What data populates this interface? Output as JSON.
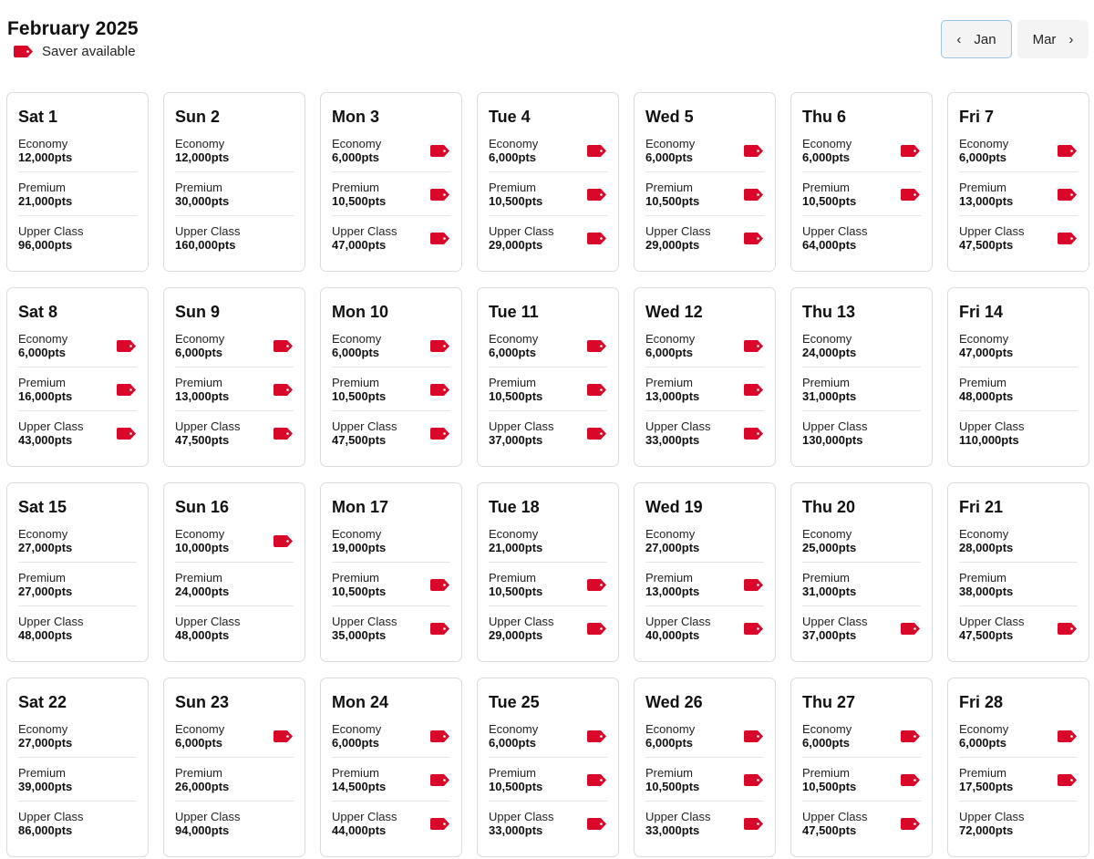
{
  "header": {
    "title": "February 2025",
    "legend_label": "Saver available",
    "saver_color": "#d9072a"
  },
  "nav": {
    "prev_label": "Jan",
    "next_label": "Mar"
  },
  "fare_classes": [
    "Economy",
    "Premium",
    "Upper Class"
  ],
  "days": [
    {
      "label": "Sat 1",
      "fares": [
        {
          "pts": "12,000pts",
          "saver": false
        },
        {
          "pts": "21,000pts",
          "saver": false
        },
        {
          "pts": "96,000pts",
          "saver": false
        }
      ]
    },
    {
      "label": "Sun 2",
      "fares": [
        {
          "pts": "12,000pts",
          "saver": false
        },
        {
          "pts": "30,000pts",
          "saver": false
        },
        {
          "pts": "160,000pts",
          "saver": false
        }
      ]
    },
    {
      "label": "Mon 3",
      "fares": [
        {
          "pts": "6,000pts",
          "saver": true
        },
        {
          "pts": "10,500pts",
          "saver": true
        },
        {
          "pts": "47,000pts",
          "saver": true
        }
      ]
    },
    {
      "label": "Tue 4",
      "fares": [
        {
          "pts": "6,000pts",
          "saver": true
        },
        {
          "pts": "10,500pts",
          "saver": true
        },
        {
          "pts": "29,000pts",
          "saver": true
        }
      ]
    },
    {
      "label": "Wed 5",
      "fares": [
        {
          "pts": "6,000pts",
          "saver": true
        },
        {
          "pts": "10,500pts",
          "saver": true
        },
        {
          "pts": "29,000pts",
          "saver": true
        }
      ]
    },
    {
      "label": "Thu 6",
      "fares": [
        {
          "pts": "6,000pts",
          "saver": true
        },
        {
          "pts": "10,500pts",
          "saver": true
        },
        {
          "pts": "64,000pts",
          "saver": false
        }
      ]
    },
    {
      "label": "Fri 7",
      "fares": [
        {
          "pts": "6,000pts",
          "saver": true
        },
        {
          "pts": "13,000pts",
          "saver": true
        },
        {
          "pts": "47,500pts",
          "saver": true
        }
      ]
    },
    {
      "label": "Sat 8",
      "fares": [
        {
          "pts": "6,000pts",
          "saver": true
        },
        {
          "pts": "16,000pts",
          "saver": true
        },
        {
          "pts": "43,000pts",
          "saver": true
        }
      ]
    },
    {
      "label": "Sun 9",
      "fares": [
        {
          "pts": "6,000pts",
          "saver": true
        },
        {
          "pts": "13,000pts",
          "saver": true
        },
        {
          "pts": "47,500pts",
          "saver": true
        }
      ]
    },
    {
      "label": "Mon 10",
      "fares": [
        {
          "pts": "6,000pts",
          "saver": true
        },
        {
          "pts": "10,500pts",
          "saver": true
        },
        {
          "pts": "47,500pts",
          "saver": true
        }
      ]
    },
    {
      "label": "Tue 11",
      "fares": [
        {
          "pts": "6,000pts",
          "saver": true
        },
        {
          "pts": "10,500pts",
          "saver": true
        },
        {
          "pts": "37,000pts",
          "saver": true
        }
      ]
    },
    {
      "label": "Wed 12",
      "fares": [
        {
          "pts": "6,000pts",
          "saver": true
        },
        {
          "pts": "13,000pts",
          "saver": true
        },
        {
          "pts": "33,000pts",
          "saver": true
        }
      ]
    },
    {
      "label": "Thu 13",
      "fares": [
        {
          "pts": "24,000pts",
          "saver": false
        },
        {
          "pts": "31,000pts",
          "saver": false
        },
        {
          "pts": "130,000pts",
          "saver": false
        }
      ]
    },
    {
      "label": "Fri 14",
      "fares": [
        {
          "pts": "47,000pts",
          "saver": false
        },
        {
          "pts": "48,000pts",
          "saver": false
        },
        {
          "pts": "110,000pts",
          "saver": false
        }
      ]
    },
    {
      "label": "Sat 15",
      "fares": [
        {
          "pts": "27,000pts",
          "saver": false
        },
        {
          "pts": "27,000pts",
          "saver": false
        },
        {
          "pts": "48,000pts",
          "saver": false
        }
      ]
    },
    {
      "label": "Sun 16",
      "fares": [
        {
          "pts": "10,000pts",
          "saver": true
        },
        {
          "pts": "24,000pts",
          "saver": false
        },
        {
          "pts": "48,000pts",
          "saver": false
        }
      ]
    },
    {
      "label": "Mon 17",
      "fares": [
        {
          "pts": "19,000pts",
          "saver": false
        },
        {
          "pts": "10,500pts",
          "saver": true
        },
        {
          "pts": "35,000pts",
          "saver": true
        }
      ]
    },
    {
      "label": "Tue 18",
      "fares": [
        {
          "pts": "21,000pts",
          "saver": false
        },
        {
          "pts": "10,500pts",
          "saver": true
        },
        {
          "pts": "29,000pts",
          "saver": true
        }
      ]
    },
    {
      "label": "Wed 19",
      "fares": [
        {
          "pts": "27,000pts",
          "saver": false
        },
        {
          "pts": "13,000pts",
          "saver": true
        },
        {
          "pts": "40,000pts",
          "saver": true
        }
      ]
    },
    {
      "label": "Thu 20",
      "fares": [
        {
          "pts": "25,000pts",
          "saver": false
        },
        {
          "pts": "31,000pts",
          "saver": false
        },
        {
          "pts": "37,000pts",
          "saver": true
        }
      ]
    },
    {
      "label": "Fri 21",
      "fares": [
        {
          "pts": "28,000pts",
          "saver": false
        },
        {
          "pts": "38,000pts",
          "saver": false
        },
        {
          "pts": "47,500pts",
          "saver": true
        }
      ]
    },
    {
      "label": "Sat 22",
      "fares": [
        {
          "pts": "27,000pts",
          "saver": false
        },
        {
          "pts": "39,000pts",
          "saver": false
        },
        {
          "pts": "86,000pts",
          "saver": false
        }
      ]
    },
    {
      "label": "Sun 23",
      "fares": [
        {
          "pts": "6,000pts",
          "saver": true
        },
        {
          "pts": "26,000pts",
          "saver": false
        },
        {
          "pts": "94,000pts",
          "saver": false
        }
      ]
    },
    {
      "label": "Mon 24",
      "fares": [
        {
          "pts": "6,000pts",
          "saver": true
        },
        {
          "pts": "14,500pts",
          "saver": true
        },
        {
          "pts": "44,000pts",
          "saver": true
        }
      ]
    },
    {
      "label": "Tue 25",
      "fares": [
        {
          "pts": "6,000pts",
          "saver": true
        },
        {
          "pts": "10,500pts",
          "saver": true
        },
        {
          "pts": "33,000pts",
          "saver": true
        }
      ]
    },
    {
      "label": "Wed 26",
      "fares": [
        {
          "pts": "6,000pts",
          "saver": true
        },
        {
          "pts": "10,500pts",
          "saver": true
        },
        {
          "pts": "33,000pts",
          "saver": true
        }
      ]
    },
    {
      "label": "Thu 27",
      "fares": [
        {
          "pts": "6,000pts",
          "saver": true
        },
        {
          "pts": "10,500pts",
          "saver": true
        },
        {
          "pts": "47,500pts",
          "saver": true
        }
      ]
    },
    {
      "label": "Fri 28",
      "fares": [
        {
          "pts": "6,000pts",
          "saver": true
        },
        {
          "pts": "17,500pts",
          "saver": true
        },
        {
          "pts": "72,000pts",
          "saver": false
        }
      ]
    }
  ]
}
